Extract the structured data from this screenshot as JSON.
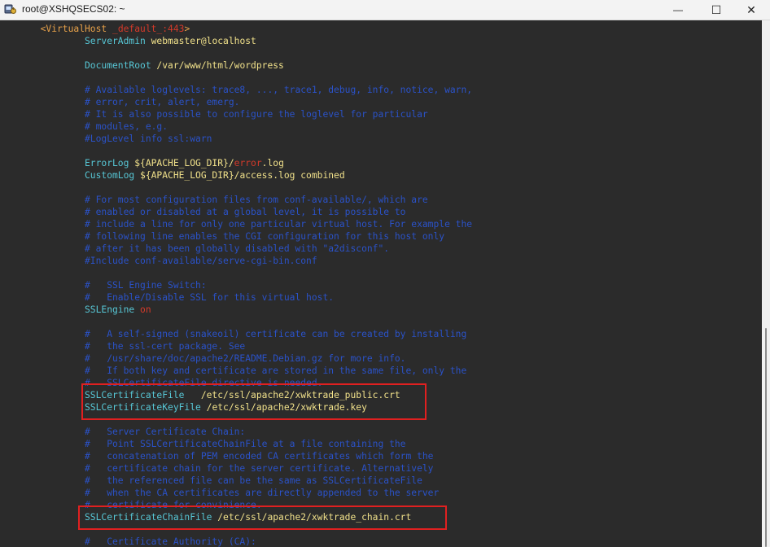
{
  "window": {
    "title": "root@XSHQSECS02: ~",
    "minimize_symbol": "—",
    "maximize_symbol": "☐",
    "close_symbol": "✕"
  },
  "config_lines": [
    {
      "indent": 7,
      "parts": [
        {
          "t": "<VirtualHost ",
          "c": "tag"
        },
        {
          "t": "_default_:443",
          "c": "red"
        },
        {
          "t": ">",
          "c": "tag"
        }
      ]
    },
    {
      "indent": 15,
      "parts": [
        {
          "t": "ServerAdmin ",
          "c": "dir"
        },
        {
          "t": "webmaster@localhost",
          "c": "val"
        }
      ]
    },
    {
      "indent": 0,
      "parts": []
    },
    {
      "indent": 15,
      "parts": [
        {
          "t": "DocumentRoot ",
          "c": "dir"
        },
        {
          "t": "/var/www/html/wordpress",
          "c": "val"
        }
      ]
    },
    {
      "indent": 0,
      "parts": []
    },
    {
      "indent": 15,
      "parts": [
        {
          "t": "# Available loglevels: trace8, ..., trace1, debug, info, notice, warn,",
          "c": "cmt"
        }
      ]
    },
    {
      "indent": 15,
      "parts": [
        {
          "t": "# error, crit, alert, emerg.",
          "c": "cmt"
        }
      ]
    },
    {
      "indent": 15,
      "parts": [
        {
          "t": "# It is also possible to configure the loglevel for particular",
          "c": "cmt"
        }
      ]
    },
    {
      "indent": 15,
      "parts": [
        {
          "t": "# modules, e.g.",
          "c": "cmt"
        }
      ]
    },
    {
      "indent": 15,
      "parts": [
        {
          "t": "#LogLevel info ssl:warn",
          "c": "cmt"
        }
      ]
    },
    {
      "indent": 0,
      "parts": []
    },
    {
      "indent": 15,
      "parts": [
        {
          "t": "ErrorLog ",
          "c": "dir"
        },
        {
          "t": "${APACHE_LOG_DIR}/",
          "c": "val"
        },
        {
          "t": "error",
          "c": "red"
        },
        {
          "t": ".log",
          "c": "val"
        }
      ]
    },
    {
      "indent": 15,
      "parts": [
        {
          "t": "CustomLog ",
          "c": "dir"
        },
        {
          "t": "${APACHE_LOG_DIR}/access.log combined",
          "c": "val"
        }
      ]
    },
    {
      "indent": 0,
      "parts": []
    },
    {
      "indent": 15,
      "parts": [
        {
          "t": "# For most configuration files from conf-available/, which are",
          "c": "cmt"
        }
      ]
    },
    {
      "indent": 15,
      "parts": [
        {
          "t": "# enabled or disabled at a global level, it is possible to",
          "c": "cmt"
        }
      ]
    },
    {
      "indent": 15,
      "parts": [
        {
          "t": "# include a line for only one particular virtual host. For example the",
          "c": "cmt"
        }
      ]
    },
    {
      "indent": 15,
      "parts": [
        {
          "t": "# following line enables the CGI configuration for this host only",
          "c": "cmt"
        }
      ]
    },
    {
      "indent": 15,
      "parts": [
        {
          "t": "# after it has been globally disabled with \"a2disconf\".",
          "c": "cmt"
        }
      ]
    },
    {
      "indent": 15,
      "parts": [
        {
          "t": "#Include conf-available/serve-cgi-bin.conf",
          "c": "cmt"
        }
      ]
    },
    {
      "indent": 0,
      "parts": []
    },
    {
      "indent": 15,
      "parts": [
        {
          "t": "#   SSL Engine Switch:",
          "c": "cmt"
        }
      ]
    },
    {
      "indent": 15,
      "parts": [
        {
          "t": "#   Enable/Disable SSL for this virtual host.",
          "c": "cmt"
        }
      ]
    },
    {
      "indent": 15,
      "parts": [
        {
          "t": "SSLEngine ",
          "c": "dir"
        },
        {
          "t": "on",
          "c": "red"
        }
      ]
    },
    {
      "indent": 0,
      "parts": []
    },
    {
      "indent": 15,
      "parts": [
        {
          "t": "#   A self-signed (snakeoil) certificate can be created by installing",
          "c": "cmt"
        }
      ]
    },
    {
      "indent": 15,
      "parts": [
        {
          "t": "#   the ssl-cert package. See",
          "c": "cmt"
        }
      ]
    },
    {
      "indent": 15,
      "parts": [
        {
          "t": "#   /usr/share/doc/apache2/README.Debian.gz for more info.",
          "c": "cmt"
        }
      ]
    },
    {
      "indent": 15,
      "parts": [
        {
          "t": "#   If both key and certificate are stored in the same file, only the",
          "c": "cmt"
        }
      ]
    },
    {
      "indent": 15,
      "parts": [
        {
          "t": "#   SSLCertificateFile directive is needed.",
          "c": "cmt"
        }
      ]
    },
    {
      "indent": 15,
      "parts": [
        {
          "t": "SSLCertificateFile  ",
          "c": "dir"
        },
        {
          "t": " /etc/ssl/apache2/xwktrade_public.crt",
          "c": "val"
        }
      ]
    },
    {
      "indent": 15,
      "parts": [
        {
          "t": "SSLCertificateKeyFile ",
          "c": "dir"
        },
        {
          "t": "/etc/ssl/apache2/xwktrade.key",
          "c": "val"
        }
      ]
    },
    {
      "indent": 0,
      "parts": []
    },
    {
      "indent": 15,
      "parts": [
        {
          "t": "#   Server Certificate Chain:",
          "c": "cmt"
        }
      ]
    },
    {
      "indent": 15,
      "parts": [
        {
          "t": "#   Point SSLCertificateChainFile at a file containing the",
          "c": "cmt"
        }
      ]
    },
    {
      "indent": 15,
      "parts": [
        {
          "t": "#   concatenation of PEM encoded CA certificates which form the",
          "c": "cmt"
        }
      ]
    },
    {
      "indent": 15,
      "parts": [
        {
          "t": "#   certificate chain for the server certificate. Alternatively",
          "c": "cmt"
        }
      ]
    },
    {
      "indent": 15,
      "parts": [
        {
          "t": "#   the referenced file can be the same as SSLCertificateFile",
          "c": "cmt"
        }
      ]
    },
    {
      "indent": 15,
      "parts": [
        {
          "t": "#   when the CA certificates are directly appended to the server",
          "c": "cmt"
        }
      ]
    },
    {
      "indent": 15,
      "parts": [
        {
          "t": "#   certificate for convinience.",
          "c": "cmt"
        }
      ]
    },
    {
      "indent": 15,
      "parts": [
        {
          "t": "SSLCertificateChainFile ",
          "c": "dir"
        },
        {
          "t": "/etc/ssl/apache2/xwktrade_chain.crt",
          "c": "val"
        }
      ]
    },
    {
      "indent": 0,
      "parts": []
    },
    {
      "indent": 15,
      "parts": [
        {
          "t": "#   Certificate Authority (CA):",
          "c": "cmt"
        }
      ]
    }
  ],
  "highlights": [
    {
      "name": "highlight-box-cert-and-key",
      "first_line": 30,
      "last_line": 31
    },
    {
      "name": "highlight-box-chain-file",
      "first_line": 40,
      "last_line": 40
    }
  ]
}
